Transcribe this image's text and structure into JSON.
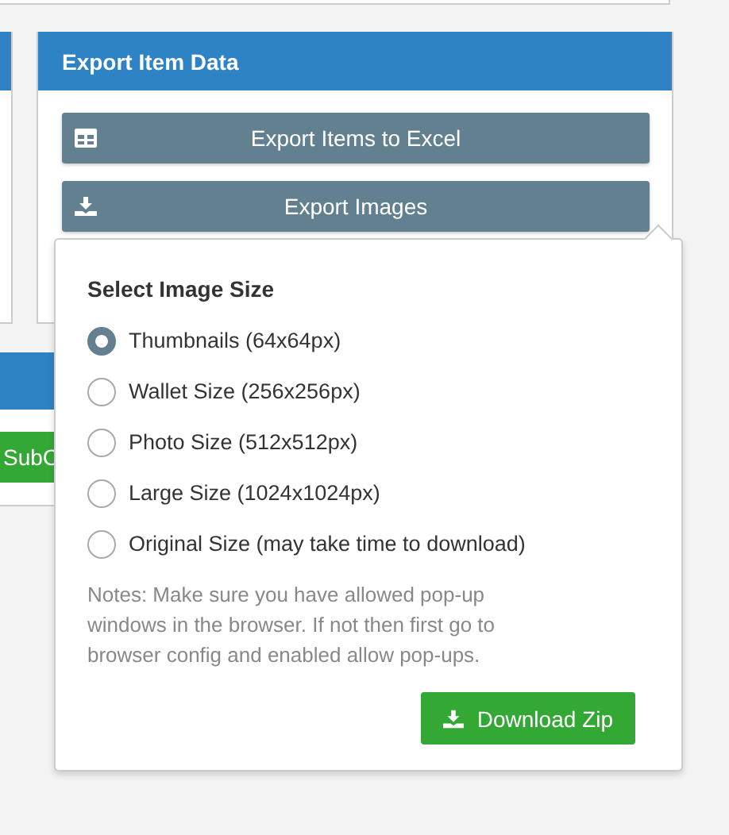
{
  "left_panel": {
    "button": "SubC"
  },
  "export_panel": {
    "title": "Export Item Data",
    "buttons": [
      {
        "label": "Export Items to Excel"
      },
      {
        "label": "Export Images"
      }
    ]
  },
  "popover": {
    "title": "Select Image Size",
    "options": [
      {
        "label": "Thumbnails (64x64px)",
        "selected": true
      },
      {
        "label": "Wallet Size (256x256px)",
        "selected": false
      },
      {
        "label": "Photo Size (512x512px)",
        "selected": false
      },
      {
        "label": "Large Size (1024x1024px)",
        "selected": false
      },
      {
        "label": "Original Size (may take time to download)",
        "selected": false
      }
    ],
    "note": "Notes: Make sure you have allowed pop-up windows in the browser. If not then first go to browser config and enabled allow pop-ups.",
    "button": "Download Zip"
  }
}
